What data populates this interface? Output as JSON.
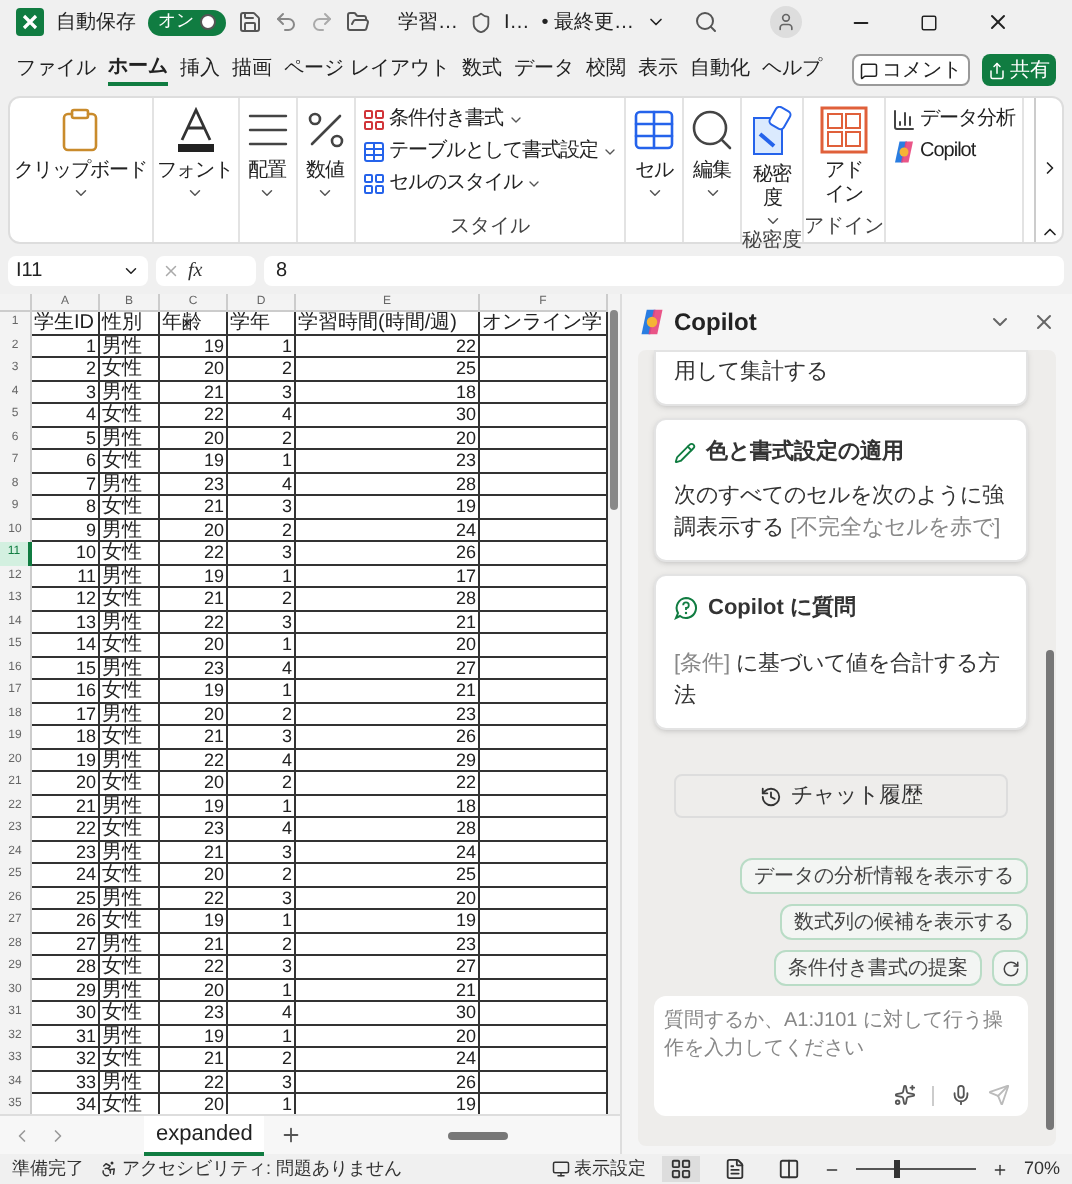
{
  "title_bar": {
    "autosave_label": "自動保存",
    "autosave": {
      "label": "オン",
      "on": true
    },
    "file_name": "学習…",
    "sensitivity": "I…",
    "saved_status": "• 最終更…"
  },
  "menu_tabs": [
    {
      "label": "ファイル",
      "selected": false
    },
    {
      "label": "ホーム",
      "selected": true
    },
    {
      "label": "挿入",
      "selected": false
    },
    {
      "label": "描画",
      "selected": false
    },
    {
      "label": "ページ レイアウト",
      "selected": false
    },
    {
      "label": "数式",
      "selected": false
    },
    {
      "label": "データ",
      "selected": false
    },
    {
      "label": "校閲",
      "selected": false
    },
    {
      "label": "表示",
      "selected": false
    },
    {
      "label": "自動化",
      "selected": false
    },
    {
      "label": "ヘルプ",
      "selected": false
    }
  ],
  "comment_button": "コメント",
  "share_button": "共有",
  "ribbon": [
    {
      "kind": "large",
      "label": "クリップボード",
      "dropdown": true
    },
    {
      "kind": "large",
      "label": "フォント",
      "dropdown": true
    },
    {
      "kind": "large",
      "label": "配置",
      "dropdown": true
    },
    {
      "kind": "large",
      "label": "数値",
      "dropdown": true
    },
    {
      "kind": "list",
      "group_label": "スタイル",
      "items": [
        {
          "label": "条件付き書式",
          "dropdown": true
        },
        {
          "label": "テーブルとして書式設定",
          "dropdown": true
        },
        {
          "label": "セルのスタイル",
          "dropdown": true
        }
      ]
    },
    {
      "kind": "large",
      "label": "セル",
      "dropdown": true
    },
    {
      "kind": "large",
      "label": "編集",
      "dropdown": true
    },
    {
      "kind": "large",
      "label": "秘密度",
      "dropdown": true,
      "group_label": "秘密度"
    },
    {
      "kind": "large",
      "label": "アドイン",
      "dropdown": false,
      "group_label": "アドイン"
    },
    {
      "kind": "list",
      "items": [
        {
          "label": "データ分析",
          "dropdown": false
        },
        {
          "label": "Copilot",
          "dropdown": false
        }
      ]
    }
  ],
  "formula_bar": {
    "name_box": "I11",
    "fx_label": "fx",
    "formula": "8"
  },
  "sheet": {
    "header_row_number": "1",
    "columns": [
      {
        "letter": "A",
        "header": "学生ID",
        "kind": "number"
      },
      {
        "letter": "B",
        "header": "性別",
        "kind": "text"
      },
      {
        "letter": "C",
        "header": "年齢",
        "kind": "number"
      },
      {
        "letter": "D",
        "header": "学年",
        "kind": "number"
      },
      {
        "letter": "E",
        "header": "学習時間(時間/週)",
        "kind": "number"
      },
      {
        "letter": "F",
        "header": "オンライン学",
        "kind": "text"
      }
    ],
    "rows": [
      {
        "number": "2",
        "selected": false,
        "cells": [
          "1",
          "男性",
          "19",
          "1",
          "22"
        ]
      },
      {
        "number": "3",
        "selected": false,
        "cells": [
          "2",
          "女性",
          "20",
          "2",
          "25"
        ]
      },
      {
        "number": "4",
        "selected": false,
        "cells": [
          "3",
          "男性",
          "21",
          "3",
          "18"
        ]
      },
      {
        "number": "5",
        "selected": false,
        "cells": [
          "4",
          "女性",
          "22",
          "4",
          "30"
        ]
      },
      {
        "number": "6",
        "selected": false,
        "cells": [
          "5",
          "男性",
          "20",
          "2",
          "20"
        ]
      },
      {
        "number": "7",
        "selected": false,
        "cells": [
          "6",
          "女性",
          "19",
          "1",
          "23"
        ]
      },
      {
        "number": "8",
        "selected": false,
        "cells": [
          "7",
          "男性",
          "23",
          "4",
          "28"
        ]
      },
      {
        "number": "9",
        "selected": false,
        "cells": [
          "8",
          "女性",
          "21",
          "3",
          "19"
        ]
      },
      {
        "number": "10",
        "selected": false,
        "cells": [
          "9",
          "男性",
          "20",
          "2",
          "24"
        ]
      },
      {
        "number": "11",
        "selected": true,
        "cells": [
          "10",
          "女性",
          "22",
          "3",
          "26"
        ]
      },
      {
        "number": "12",
        "selected": false,
        "cells": [
          "11",
          "男性",
          "19",
          "1",
          "17"
        ]
      },
      {
        "number": "13",
        "selected": false,
        "cells": [
          "12",
          "女性",
          "21",
          "2",
          "28"
        ]
      },
      {
        "number": "14",
        "selected": false,
        "cells": [
          "13",
          "男性",
          "22",
          "3",
          "21"
        ]
      },
      {
        "number": "15",
        "selected": false,
        "cells": [
          "14",
          "女性",
          "20",
          "1",
          "20"
        ]
      },
      {
        "number": "16",
        "selected": false,
        "cells": [
          "15",
          "男性",
          "23",
          "4",
          "27"
        ]
      },
      {
        "number": "17",
        "selected": false,
        "cells": [
          "16",
          "女性",
          "19",
          "1",
          "21"
        ]
      },
      {
        "number": "18",
        "selected": false,
        "cells": [
          "17",
          "男性",
          "20",
          "2",
          "23"
        ]
      },
      {
        "number": "19",
        "selected": false,
        "cells": [
          "18",
          "女性",
          "21",
          "3",
          "26"
        ]
      },
      {
        "number": "20",
        "selected": false,
        "cells": [
          "19",
          "男性",
          "22",
          "4",
          "29"
        ]
      },
      {
        "number": "21",
        "selected": false,
        "cells": [
          "20",
          "女性",
          "20",
          "2",
          "22"
        ]
      },
      {
        "number": "22",
        "selected": false,
        "cells": [
          "21",
          "男性",
          "19",
          "1",
          "18"
        ]
      },
      {
        "number": "23",
        "selected": false,
        "cells": [
          "22",
          "女性",
          "23",
          "4",
          "28"
        ]
      },
      {
        "number": "24",
        "selected": false,
        "cells": [
          "23",
          "男性",
          "21",
          "3",
          "24"
        ]
      },
      {
        "number": "25",
        "selected": false,
        "cells": [
          "24",
          "女性",
          "20",
          "2",
          "25"
        ]
      },
      {
        "number": "26",
        "selected": false,
        "cells": [
          "25",
          "男性",
          "22",
          "3",
          "20"
        ]
      },
      {
        "number": "27",
        "selected": false,
        "cells": [
          "26",
          "女性",
          "19",
          "1",
          "19"
        ]
      },
      {
        "number": "28",
        "selected": false,
        "cells": [
          "27",
          "男性",
          "21",
          "2",
          "23"
        ]
      },
      {
        "number": "29",
        "selected": false,
        "cells": [
          "28",
          "女性",
          "22",
          "3",
          "27"
        ]
      },
      {
        "number": "30",
        "selected": false,
        "cells": [
          "29",
          "男性",
          "20",
          "1",
          "21"
        ]
      },
      {
        "number": "31",
        "selected": false,
        "cells": [
          "30",
          "女性",
          "23",
          "4",
          "30"
        ]
      },
      {
        "number": "32",
        "selected": false,
        "cells": [
          "31",
          "男性",
          "19",
          "1",
          "20"
        ]
      },
      {
        "number": "33",
        "selected": false,
        "cells": [
          "32",
          "女性",
          "21",
          "2",
          "24"
        ]
      },
      {
        "number": "34",
        "selected": false,
        "cells": [
          "33",
          "男性",
          "22",
          "3",
          "26"
        ]
      },
      {
        "number": "35",
        "selected": false,
        "cells": [
          "34",
          "女性",
          "20",
          "1",
          "19"
        ]
      }
    ],
    "tabs": [
      {
        "label": "expanded",
        "selected": true
      }
    ]
  },
  "copilot": {
    "title": "Copilot",
    "cards": [
      {
        "kind": "partial",
        "parts": [
          {
            "text": "用して集計する",
            "muted": false
          }
        ]
      },
      {
        "kind": "format",
        "title": "色と書式設定の適用",
        "parts": [
          {
            "text": "次のすべてのセルを次のように強調表示する ",
            "muted": false
          },
          {
            "text": "[不完全なセルを赤で]",
            "muted": true
          }
        ]
      },
      {
        "kind": "question",
        "title": "Copilot に質問",
        "parts": [
          {
            "text": "[条件]",
            "muted": true
          },
          {
            "text": " に基づいて値を合計する方法",
            "muted": false
          }
        ]
      }
    ],
    "history_button": "チャット履歴",
    "suggestions": [
      "データの分析情報を表示する",
      "数式列の候補を表示する",
      "条件付き書式の提案"
    ],
    "input": {
      "placeholder": "質問するか、A1:J101 に対して行う操作を入力してください"
    }
  },
  "status_bar": {
    "ready": "準備完了",
    "accessibility": "アクセシビリティ: 問題ありません",
    "display_settings": "表示設定",
    "views": [
      {
        "kind": "normal",
        "selected": true
      },
      {
        "kind": "page_layout",
        "selected": false
      },
      {
        "kind": "page_break",
        "selected": false
      }
    ],
    "zoom": {
      "level": 0.35,
      "reading": "70%"
    }
  }
}
